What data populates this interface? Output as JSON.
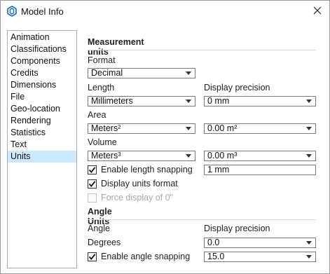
{
  "window": {
    "title": "Model Info",
    "close_glyph": "✕",
    "icon": "sketchup-logo-icon",
    "accent": "#1b6fb8"
  },
  "sidebar": {
    "selected": "Units",
    "selected_color": "#cce8ff",
    "items": [
      "Animation",
      "Classifications",
      "Components",
      "Credits",
      "Dimensions",
      "File",
      "Geo-location",
      "Rendering",
      "Statistics",
      "Text",
      "Units"
    ]
  },
  "measurement": {
    "heading": "Measurement units",
    "format": {
      "label": "Format",
      "value": "Decimal"
    },
    "length": {
      "label": "Length",
      "value": "Millimeters"
    },
    "display_precision": {
      "label": "Display precision",
      "value": "0 mm"
    },
    "area": {
      "label": "Area",
      "value": "Meters²",
      "precision": "0.00 m²"
    },
    "volume": {
      "label": "Volume",
      "value": "Meters³",
      "precision": "0.00 m³"
    },
    "length_snapping": {
      "label": "Enable length snapping",
      "checked": true,
      "value": "1 mm"
    },
    "display_units_format": {
      "label": "Display units format",
      "checked": true
    },
    "force_display": {
      "label": "Force display of 0\"",
      "checked": false,
      "disabled": true
    }
  },
  "angle": {
    "heading": "Angle Units",
    "angle_label": "Angle",
    "display_precision_label": "Display precision",
    "unit": {
      "value": "Degrees"
    },
    "precision": {
      "value": "0.0"
    },
    "snapping": {
      "label": "Enable angle snapping",
      "checked": true,
      "value": "15.0"
    }
  }
}
